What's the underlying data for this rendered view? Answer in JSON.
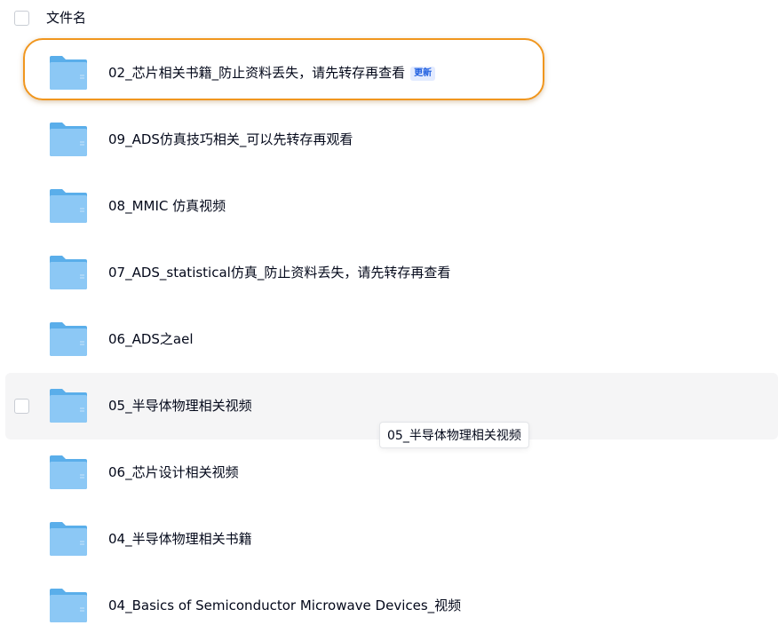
{
  "header": {
    "column_label": "文件名"
  },
  "files": [
    {
      "name": "02_芯片相关书籍_防止资料丢失，请先转存再查看",
      "badge": "更新"
    },
    {
      "name": "09_ADS仿真技巧相关_可以先转存再观看"
    },
    {
      "name": "08_MMIC 仿真视频"
    },
    {
      "name": "07_ADS_statistical仿真_防止资料丢失，请先转存再查看"
    },
    {
      "name": "06_ADS之ael"
    },
    {
      "name": "05_半导体物理相关视频"
    },
    {
      "name": "06_芯片设计相关视频"
    },
    {
      "name": "04_半导体物理相关书籍"
    },
    {
      "name": "04_Basics of Semiconductor Microwave Devices_视频"
    }
  ],
  "tooltip": {
    "text": "05_半导体物理相关视频"
  },
  "colors": {
    "folder_body": "#8cc8f5",
    "folder_back": "#5aaeea",
    "highlight_ring": "#f0961e",
    "badge_bg": "#e3ebff",
    "badge_text": "#1f5fe0",
    "hover_row": "#f5f5f6"
  },
  "icons": {
    "folder": "folder-icon"
  }
}
